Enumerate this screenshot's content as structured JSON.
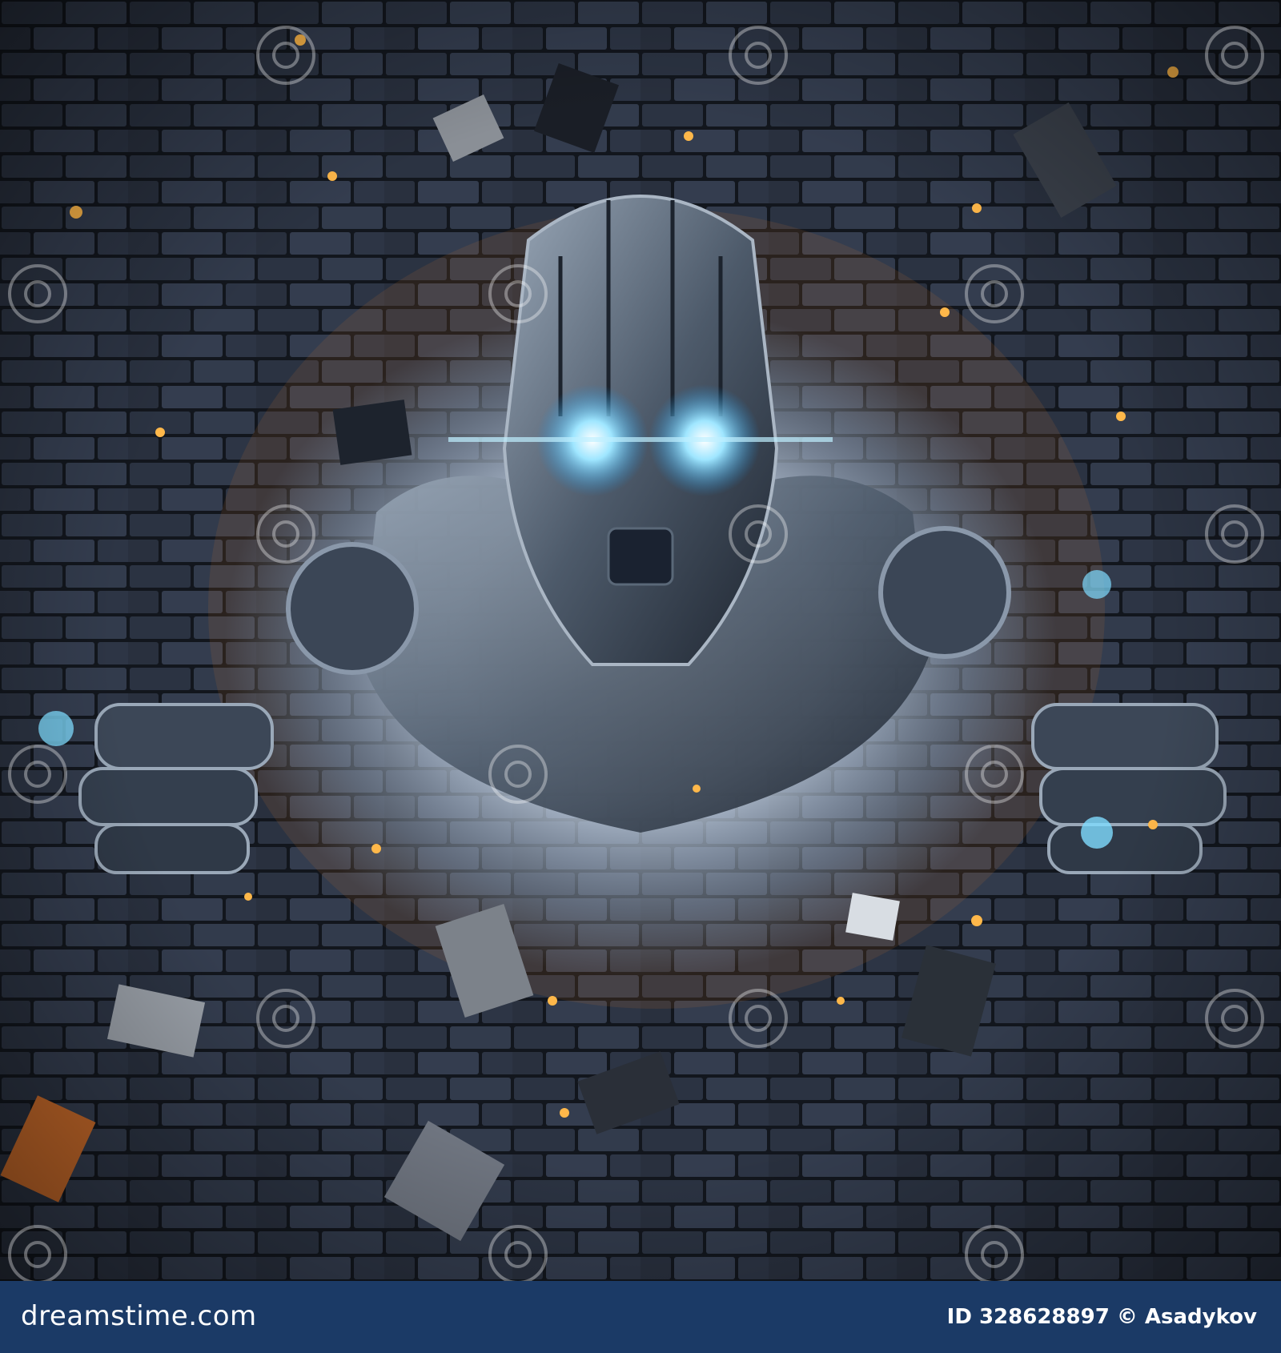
{
  "photo": {
    "subject": "robot breaking through brick wall",
    "colors": {
      "brick": "#2a3140",
      "mortar": "#11151c",
      "glow": "#e8f4ff",
      "eyes": "#6fd6ff",
      "sparks": "#ffb84a",
      "metal": "#5a6878"
    }
  },
  "watermark": {
    "text": "dreamstime"
  },
  "footer": {
    "brand": "dreamstime.com",
    "credit": "ID 328628897 © Asadykov",
    "background": "#1b3a66"
  }
}
